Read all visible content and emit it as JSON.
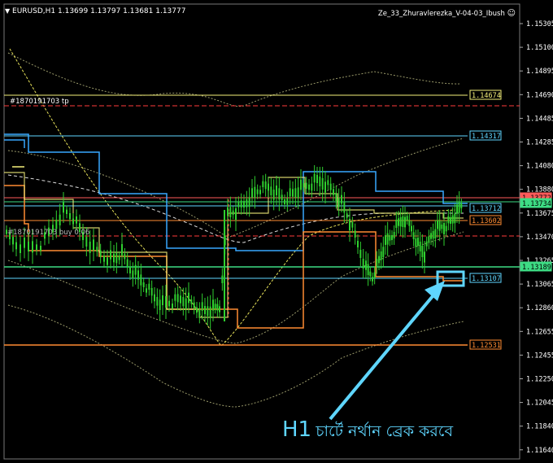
{
  "header": {
    "symbol_info": "EURUSD,H1  1.13699  1.13797  1.13681  1.13777",
    "ea_name": "Ze_33_Zhuravlerezka_V-04-03_Ibush"
  },
  "order_label": "#1870191703 tp",
  "overlap_text": "#1870191703 buy 0.06",
  "annotation": {
    "prefix": "H1",
    "text": "চার্টে নর্থান ব্রেক করবে"
  },
  "price_axis": [
    "1.15305",
    "1.15100",
    "1.14895",
    "1.14690",
    "1.14485",
    "1.14285",
    "1.14080",
    "1.13880",
    "1.13675",
    "1.13470",
    "1.13265",
    "1.13065",
    "1.12860",
    "1.12655",
    "1.12455",
    "1.12250",
    "1.12045",
    "1.11840",
    "1.11640"
  ],
  "price_tags": [
    {
      "value": "1.14674",
      "color": "#f5f07a"
    },
    {
      "value": "1.14317",
      "color": "#5fd6ff"
    },
    {
      "value": "1.13772",
      "color": "#ff5a5a"
    },
    {
      "value": "1.13734",
      "color": "#3ddc84"
    },
    {
      "value": "1.13712",
      "color": "#5fd6ff"
    },
    {
      "value": "1.13602",
      "color": "#ff8c32"
    },
    {
      "value": "1.13189",
      "color": "#3ddc84"
    },
    {
      "value": "1.13107",
      "color": "#5fd6ff"
    },
    {
      "value": "1.12531",
      "color": "#ff8c32"
    }
  ],
  "icons": {
    "dropdown": "triangle-down-icon",
    "smiley": "smiley-face-icon"
  },
  "colors": {
    "background": "#000000",
    "candles": "#2fd12f",
    "resistance": "#5fd6ff",
    "support": "#ff8c32",
    "grid_dashed": "#ff3b3b",
    "annotation": "#5fd6ff",
    "mid_line": "#f5f07a"
  }
}
